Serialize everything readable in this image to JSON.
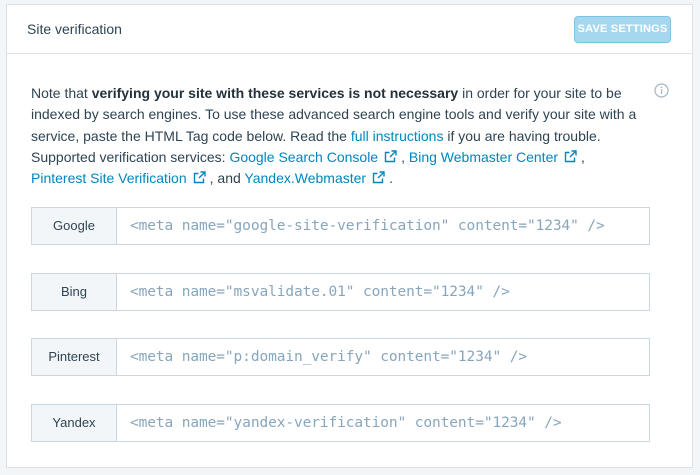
{
  "header": {
    "title": "Site verification",
    "save_label": "SAVE SETTINGS"
  },
  "note": {
    "p1": "Note that ",
    "bold": "verifying your site with these services is not necessary",
    "p2": " in order for your site to be indexed by search engines. To use these advanced search engine tools and verify your site with a service, paste the HTML Tag code below. Read the ",
    "link_instructions": "full instructions",
    "p3": " if you are having trouble. Supported verification services: ",
    "link_google": "Google Search Console",
    "sep1": ", ",
    "link_bing": "Bing Webmaster Center",
    "sep2": ", ",
    "link_pinterest": "Pinterest Site Verification",
    "sep3": ", and ",
    "link_yandex": "Yandex.Webmaster",
    "end": "."
  },
  "services": [
    {
      "label": "Google",
      "placeholder": "<meta name=\"google-site-verification\" content=\"1234\" />"
    },
    {
      "label": "Bing",
      "placeholder": "<meta name=\"msvalidate.01\" content=\"1234\" />"
    },
    {
      "label": "Pinterest",
      "placeholder": "<meta name=\"p:domain_verify\" content=\"1234\" />"
    },
    {
      "label": "Yandex",
      "placeholder": "<meta name=\"yandex-verification\" content=\"1234\" />"
    }
  ],
  "icons": {
    "info": "info-icon",
    "external": "external-link-icon"
  },
  "colors": {
    "link": "#0087be",
    "button": "#a5d8ef",
    "text": "#2e4453",
    "placeholder": "#87a6bc"
  }
}
